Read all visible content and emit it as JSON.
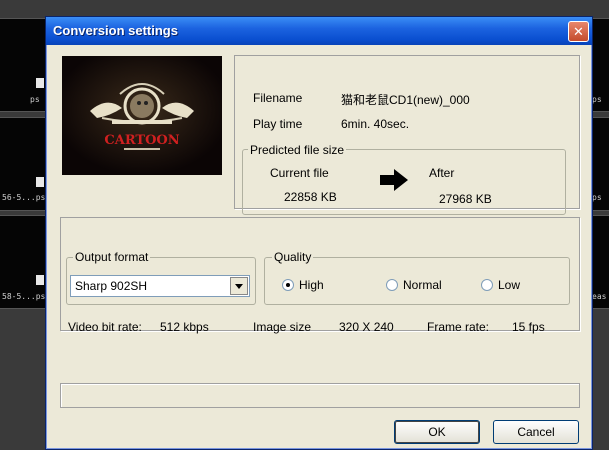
{
  "background": {
    "dash_labels": [
      "ps",
      "ps",
      "ps"
    ],
    "mid_labels": [
      "56-5...ps",
      "58-5...ps"
    ],
    "right_labels": [
      "ps",
      "ps",
      "eas"
    ]
  },
  "dialog": {
    "title": "Conversion settings",
    "close_glyph": "✕"
  },
  "thumbnail": {
    "logo_text": "CARTOON"
  },
  "file_info": {
    "filename_label": "Filename",
    "filename_value": "猫和老鼠CD1(new)_000",
    "playtime_label": "Play time",
    "playtime_value": "6min. 40sec."
  },
  "predicted": {
    "group_title": "Predicted file size",
    "current_label": "Current file",
    "current_value": "22858 KB",
    "after_label": "After",
    "after_value": "27968 KB"
  },
  "output_format": {
    "group_title": "Output format",
    "selected": "Sharp 902SH"
  },
  "quality": {
    "group_title": "Quality",
    "options": [
      {
        "label": "High",
        "selected": true
      },
      {
        "label": "Normal",
        "selected": false
      },
      {
        "label": "Low",
        "selected": false
      }
    ]
  },
  "stats": {
    "bitrate_label": "Video bit rate:",
    "bitrate_value": "512 kbps",
    "imagesize_label": "Image size",
    "imagesize_value": "320 X 240",
    "framerate_label": "Frame rate:",
    "framerate_value": "15 fps"
  },
  "buttons": {
    "ok": "OK",
    "cancel": "Cancel"
  },
  "colors": {
    "titlebar": "#0a4fd0",
    "close": "#c44b2c",
    "face": "#ece9d8"
  }
}
